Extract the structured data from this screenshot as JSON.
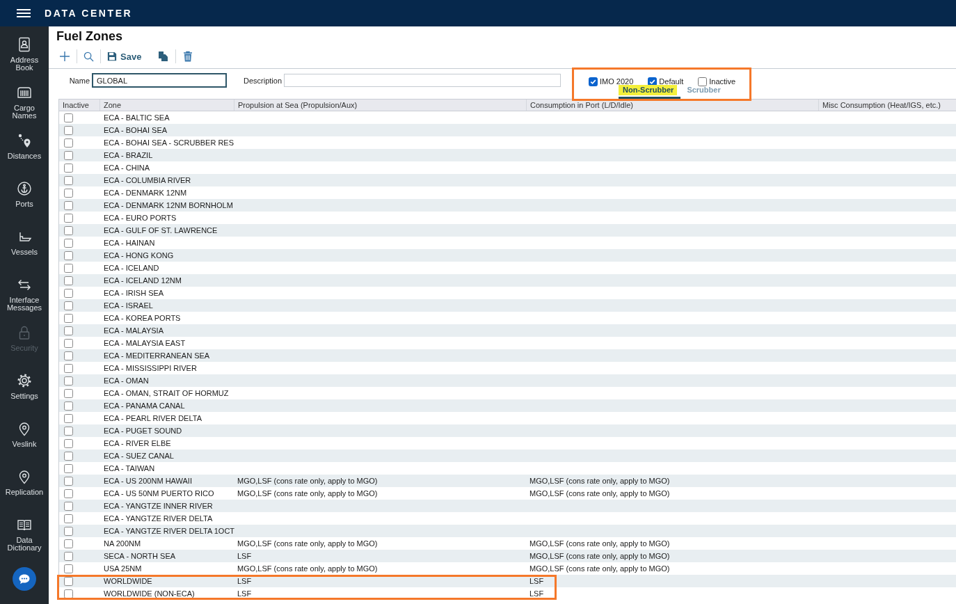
{
  "header": {
    "title": "DATA CENTER"
  },
  "sidebar": {
    "items": [
      {
        "kind": "contact",
        "label": "Address Book",
        "disabled": false
      },
      {
        "kind": "container",
        "label": "Cargo Names",
        "disabled": false
      },
      {
        "kind": "route",
        "label": "Distances",
        "disabled": false
      },
      {
        "kind": "anchor",
        "label": "Ports",
        "disabled": false
      },
      {
        "kind": "ship",
        "label": "Vessels",
        "disabled": false
      },
      {
        "kind": "arrows",
        "label": "Interface Messages",
        "disabled": false
      },
      {
        "kind": "lock",
        "label": "Security",
        "disabled": true
      },
      {
        "kind": "gear",
        "label": "Settings",
        "disabled": false
      },
      {
        "kind": "pin",
        "label": "Veslink",
        "disabled": false
      },
      {
        "kind": "pin",
        "label": "Replication",
        "disabled": false
      },
      {
        "kind": "book",
        "label": "Data Dictionary",
        "disabled": false
      }
    ]
  },
  "page": {
    "title": "Fuel Zones"
  },
  "toolbar": {
    "groups": [
      [
        {
          "kind": "add"
        }
      ],
      [
        {
          "kind": "search"
        }
      ],
      [
        {
          "kind": "save",
          "label": "Save"
        },
        {
          "kind": "copy"
        }
      ],
      [
        {
          "kind": "delete"
        }
      ]
    ]
  },
  "form": {
    "name": {
      "label": "Name",
      "value": "GLOBAL",
      "focused": true
    },
    "description": {
      "label": "Description",
      "focused": false
    }
  },
  "options": {
    "highlighted": true,
    "checkboxes": [
      {
        "label": "IMO 2020",
        "checked": true
      },
      {
        "label": "Default",
        "checked": true
      },
      {
        "label": "Inactive",
        "checked": false
      }
    ],
    "tabs": [
      {
        "label": "Non-Scrubber",
        "selected": true,
        "highlighted": true
      },
      {
        "label": "Scrubber",
        "selected": false,
        "highlighted": false
      }
    ]
  },
  "table": {
    "columns": [
      "Inactive",
      "Zone",
      "Propulsion at Sea (Propulsion/Aux)",
      "Consumption in Port (L/D/Idle)",
      "Misc Consumption (Heat/IGS, etc.)"
    ],
    "rows": [
      {
        "inactive": false,
        "zone": "ECA - BALTIC SEA",
        "highlighted": false
      },
      {
        "inactive": false,
        "zone": "ECA - BOHAI SEA",
        "highlighted": false
      },
      {
        "inactive": false,
        "zone": "ECA - BOHAI SEA - SCRUBBER RES",
        "highlighted": false
      },
      {
        "inactive": false,
        "zone": "ECA - BRAZIL",
        "highlighted": false
      },
      {
        "inactive": false,
        "zone": "ECA - CHINA",
        "highlighted": false
      },
      {
        "inactive": false,
        "zone": "ECA - COLUMBIA RIVER",
        "highlighted": false
      },
      {
        "inactive": false,
        "zone": "ECA - DENMARK 12NM",
        "highlighted": false
      },
      {
        "inactive": false,
        "zone": "ECA - DENMARK 12NM BORNHOLM",
        "highlighted": false
      },
      {
        "inactive": false,
        "zone": "ECA - EURO PORTS",
        "highlighted": false
      },
      {
        "inactive": false,
        "zone": "ECA - GULF OF ST. LAWRENCE",
        "highlighted": false
      },
      {
        "inactive": false,
        "zone": "ECA - HAINAN",
        "highlighted": false
      },
      {
        "inactive": false,
        "zone": "ECA - HONG KONG",
        "highlighted": false
      },
      {
        "inactive": false,
        "zone": "ECA - ICELAND",
        "highlighted": false
      },
      {
        "inactive": false,
        "zone": "ECA - ICELAND 12NM",
        "highlighted": false
      },
      {
        "inactive": false,
        "zone": "ECA - IRISH SEA",
        "highlighted": false
      },
      {
        "inactive": false,
        "zone": "ECA - ISRAEL",
        "highlighted": false
      },
      {
        "inactive": false,
        "zone": "ECA - KOREA PORTS",
        "highlighted": false
      },
      {
        "inactive": false,
        "zone": "ECA - MALAYSIA",
        "highlighted": false
      },
      {
        "inactive": false,
        "zone": "ECA - MALAYSIA EAST",
        "highlighted": false
      },
      {
        "inactive": false,
        "zone": "ECA - MEDITERRANEAN SEA",
        "highlighted": false
      },
      {
        "inactive": false,
        "zone": "ECA - MISSISSIPPI RIVER",
        "highlighted": false
      },
      {
        "inactive": false,
        "zone": "ECA - OMAN",
        "highlighted": false
      },
      {
        "inactive": false,
        "zone": "ECA - OMAN, STRAIT OF HORMUZ",
        "highlighted": false
      },
      {
        "inactive": false,
        "zone": "ECA - PANAMA CANAL",
        "highlighted": false
      },
      {
        "inactive": false,
        "zone": "ECA - PEARL RIVER DELTA",
        "highlighted": false
      },
      {
        "inactive": false,
        "zone": "ECA - PUGET SOUND",
        "highlighted": false
      },
      {
        "inactive": false,
        "zone": "ECA - RIVER ELBE",
        "highlighted": false
      },
      {
        "inactive": false,
        "zone": "ECA - SUEZ CANAL",
        "highlighted": false
      },
      {
        "inactive": false,
        "zone": "ECA - TAIWAN",
        "highlighted": false
      },
      {
        "inactive": false,
        "zone": "ECA - US 200NM HAWAII",
        "propulsion_at_sea": "MGO,LSF (cons rate only, apply to MGO)",
        "consumption_in_port": "MGO,LSF (cons rate only, apply to MGO)",
        "highlighted": false
      },
      {
        "inactive": false,
        "zone": "ECA - US 50NM PUERTO RICO",
        "propulsion_at_sea": "MGO,LSF (cons rate only, apply to MGO)",
        "consumption_in_port": "MGO,LSF (cons rate only, apply to MGO)",
        "highlighted": false
      },
      {
        "inactive": false,
        "zone": "ECA - YANGTZE INNER RIVER",
        "highlighted": false
      },
      {
        "inactive": false,
        "zone": "ECA - YANGTZE RIVER DELTA",
        "highlighted": false
      },
      {
        "inactive": false,
        "zone": "ECA - YANGTZE RIVER DELTA 1OCT",
        "highlighted": false
      },
      {
        "inactive": false,
        "zone": "NA 200NM",
        "propulsion_at_sea": "MGO,LSF (cons rate only, apply to MGO)",
        "consumption_in_port": "MGO,LSF (cons rate only, apply to MGO)",
        "highlighted": false
      },
      {
        "inactive": false,
        "zone": "SECA - NORTH SEA",
        "propulsion_at_sea": "LSF",
        "consumption_in_port": "MGO,LSF (cons rate only, apply to MGO)",
        "highlighted": false
      },
      {
        "inactive": false,
        "zone": "USA 25NM",
        "propulsion_at_sea": "MGO,LSF (cons rate only, apply to MGO)",
        "consumption_in_port": "MGO,LSF (cons rate only, apply to MGO)",
        "highlighted": false
      },
      {
        "inactive": false,
        "zone": "WORLDWIDE",
        "propulsion_at_sea": "LSF",
        "consumption_in_port": "LSF",
        "highlighted": true
      },
      {
        "inactive": false,
        "zone": "WORLDWIDE (NON-ECA)",
        "propulsion_at_sea": "LSF",
        "consumption_in_port": "LSF",
        "highlighted": true
      }
    ]
  }
}
